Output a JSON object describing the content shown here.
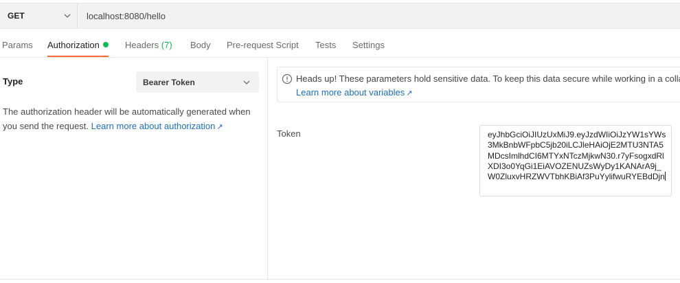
{
  "request": {
    "method": "GET",
    "url": "localhost:8080/hello"
  },
  "tabs": [
    {
      "label": "Params"
    },
    {
      "label": "Authorization"
    },
    {
      "label": "Headers",
      "count": "(7)"
    },
    {
      "label": "Body"
    },
    {
      "label": "Pre-request Script"
    },
    {
      "label": "Tests"
    },
    {
      "label": "Settings"
    }
  ],
  "auth": {
    "type_label": "Type",
    "type_value": "Bearer Token",
    "description_line1": "The authorization header will be automatically generated when",
    "description_line2": "you send the request. ",
    "description_link": "Learn more about authorization",
    "notice_text": "Heads up! These parameters hold sensitive data. To keep this data secure while working in a collab",
    "notice_link": "Learn more about variables",
    "token_label": "Token",
    "token_value": "eyJhbGciOiJIUzUxMiJ9.eyJzdWIiOiJzYW1sYWs3MkBnbWFpbC5jb20iLCJleHAiOjE2MTU3NTA5MDcsImlhdCI6MTYxNTczMjkwN30.r7yFsogxdRlXDI3o0YqGi1EiAVOZENUZsWyDy1KANArA9j_W0ZluxvHRZWVTbhKBiAf3PuYylifwuRYEBdDjn"
  },
  "colors": {
    "accent": "#ff6c37",
    "status_green": "#0cbb52",
    "link": "#1d6fc1"
  },
  "icons": {
    "method_dropdown": "chevron-down-icon",
    "type_dropdown": "chevron-down-icon",
    "notice": "info-icon",
    "external_link": "arrow-up-right-icon"
  }
}
